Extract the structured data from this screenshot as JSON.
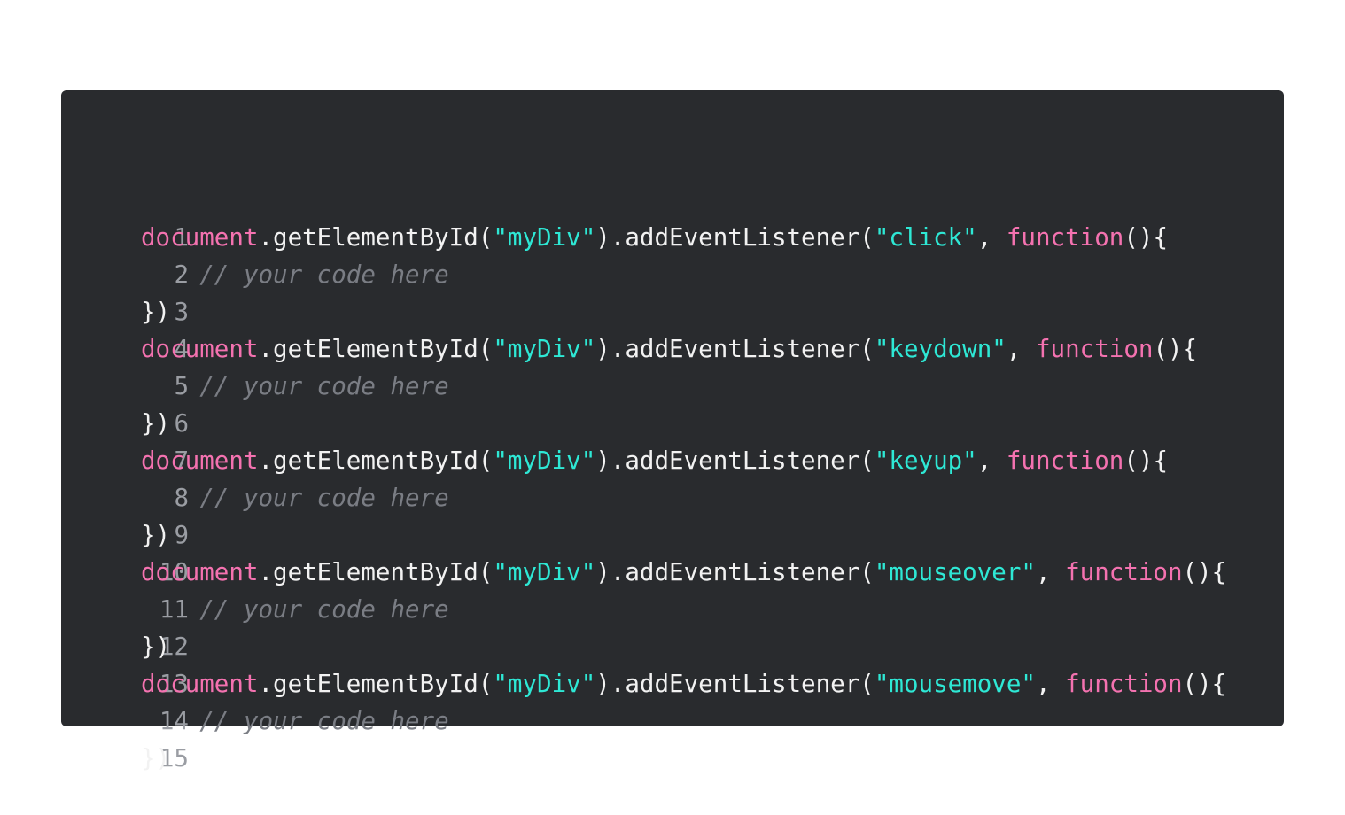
{
  "code": {
    "lines": [
      {
        "n": "1",
        "kind": "call",
        "obj": "document",
        "mid": ".getElementById(",
        "arg": "\"myDiv\"",
        "mid2": ").addEventListener(",
        "evt": "\"click\"",
        "sep": ", ",
        "kw": "function",
        "end": "(){"
      },
      {
        "n": "2",
        "kind": "comment",
        "text": "    // your code here"
      },
      {
        "n": "3",
        "kind": "plain",
        "text": "})"
      },
      {
        "n": "4",
        "kind": "call",
        "obj": "document",
        "mid": ".getElementById(",
        "arg": "\"myDiv\"",
        "mid2": ").addEventListener(",
        "evt": "\"keydown\"",
        "sep": ", ",
        "kw": "function",
        "end": "(){"
      },
      {
        "n": "5",
        "kind": "comment",
        "text": "    // your code here"
      },
      {
        "n": "6",
        "kind": "plain",
        "text": "})"
      },
      {
        "n": "7",
        "kind": "call",
        "obj": "document",
        "mid": ".getElementById(",
        "arg": "\"myDiv\"",
        "mid2": ").addEventListener(",
        "evt": "\"keyup\"",
        "sep": ", ",
        "kw": "function",
        "end": "(){"
      },
      {
        "n": "8",
        "kind": "comment",
        "text": "    // your code here"
      },
      {
        "n": "9",
        "kind": "plain",
        "text": "})"
      },
      {
        "n": "10",
        "kind": "call",
        "obj": "document",
        "mid": ".getElementById(",
        "arg": "\"myDiv\"",
        "mid2": ").addEventListener(",
        "evt": "\"mouseover\"",
        "sep": ", ",
        "kw": "function",
        "end": "(){"
      },
      {
        "n": "11",
        "kind": "comment",
        "text": "    // your code here"
      },
      {
        "n": "12",
        "kind": "plain",
        "text": "})"
      },
      {
        "n": "13",
        "kind": "call",
        "obj": "document",
        "mid": ".getElementById(",
        "arg": "\"myDiv\"",
        "mid2": ").addEventListener(",
        "evt": "\"mousemove\"",
        "sep": ", ",
        "kw": "function",
        "end": "(){"
      },
      {
        "n": "14",
        "kind": "comment",
        "text": "    // your code here"
      },
      {
        "n": "15",
        "kind": "plain",
        "text": "})"
      }
    ]
  },
  "colors": {
    "background": "#292b2e",
    "keyword": "#f472b0",
    "string": "#2ee8d5",
    "comment": "#7a7d84",
    "text": "#f2f2f2",
    "line_number": "#9a9da3"
  }
}
